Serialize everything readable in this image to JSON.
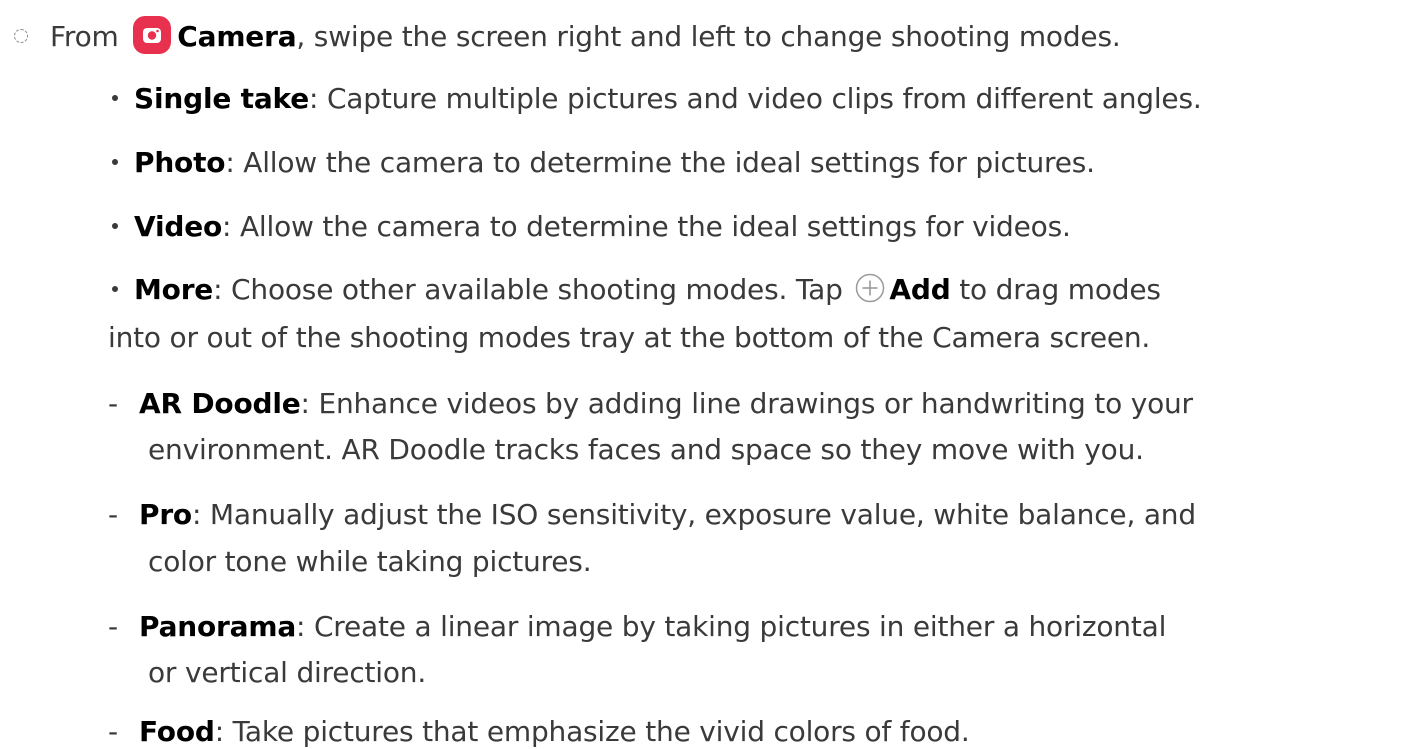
{
  "intro": {
    "prefix": "From",
    "camera_label": "Camera",
    "text": ", swipe the screen right and left to change shooting modes."
  },
  "modes": [
    {
      "term": "Single take",
      "text": ": Capture multiple pictures and video clips from different angles."
    },
    {
      "term": "Photo",
      "text": ": Allow the camera to determine the ideal settings for pictures."
    },
    {
      "term": "Video",
      "text": ": Allow the camera to determine the ideal settings for videos."
    },
    {
      "term": "More",
      "text_before": ": Choose other available shooting modes. Tap",
      "add_label": "Add",
      "text_after": "to drag modes",
      "text_line2": "into or out of the shooting modes tray at the bottom of the Camera screen."
    }
  ],
  "more_modes": [
    {
      "dash": "-",
      "term": "AR Doodle",
      "line1": ": Enhance videos by adding line drawings or handwriting to your",
      "line2": "environment. AR Doodle tracks faces and space so they move with you."
    },
    {
      "dash": "-",
      "term": "Pro",
      "line1": ": Manually adjust the ISO sensitivity, exposure value, white balance, and",
      "line2": "color tone while taking pictures."
    },
    {
      "dash": "-",
      "term": "Panorama",
      "line1": ": Create a linear image by taking pictures in either a horizontal",
      "line2": "or vertical direction."
    },
    {
      "dash": "-",
      "term": "Food",
      "line1": ": Take pictures that emphasize the vivid colors of food."
    }
  ],
  "icons": {
    "camera_app": "camera-app-icon",
    "add": "add-circle-icon",
    "camera_color": "#e8304f"
  }
}
